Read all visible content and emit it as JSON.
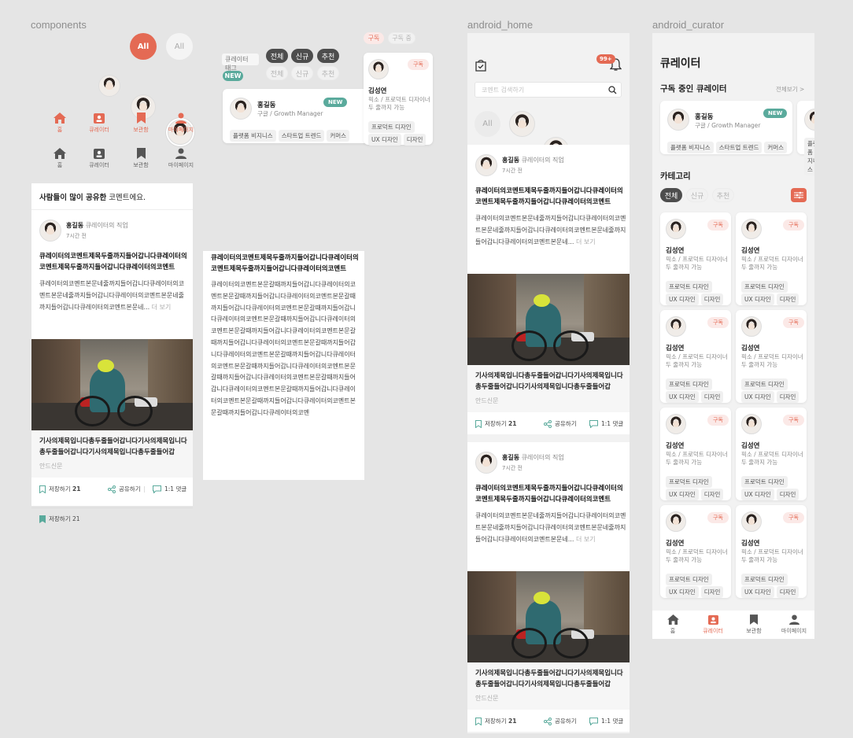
{
  "frames": {
    "components": "components",
    "android_home": "android_home",
    "android_curator": "android_curator"
  },
  "components": {
    "all_button_active": "All",
    "all_button_inactive": "All",
    "nav_active": [
      {
        "icon": "home-icon",
        "label": "홈"
      },
      {
        "icon": "curator-icon",
        "label": "큐레이터"
      },
      {
        "icon": "bookmark-icon",
        "label": "보관함"
      },
      {
        "icon": "person-icon",
        "label": "마이페이지"
      }
    ],
    "nav_inactive": [
      {
        "icon": "home-icon",
        "label": "홈"
      },
      {
        "icon": "curator-icon",
        "label": "큐레이터"
      },
      {
        "icon": "bookmark-icon",
        "label": "보관함"
      },
      {
        "icon": "person-icon",
        "label": "마이페이지"
      }
    ],
    "curator_tag_label": "큐레이터 태그",
    "new_badge": "NEW",
    "filter_dark": [
      "전체",
      "신규",
      "추천"
    ],
    "filter_light": [
      "전체",
      "신규",
      "추천"
    ],
    "sub_active": "구독",
    "sub_inactive": "구독 중",
    "profile_card": {
      "name": "홍길동",
      "role": "구글 / Growth Manager",
      "badge": "NEW",
      "tags": [
        "플랫폼 비지니스",
        "스타트업 트렌드",
        "커머스"
      ]
    },
    "curator_card": {
      "badge": "구독",
      "name": "김성연",
      "role": "픽소 / 프로덕트 디자이너 두 줄까지 가능",
      "tags": [
        "프로덕트 디자인",
        "UX 디자인",
        "디자인"
      ]
    },
    "share_header_bold": "사람들이 많이 공유한",
    "share_header_rest": " 코멘트에요.",
    "post": {
      "author": "홍길동",
      "author_job": "큐레이터의 직업",
      "time": "7시간 전",
      "title": "큐레이터의코멘트제목두줄까지들어갑니다큐레이터의코멘트제목두줄까지들어갑니다큐레이터의코멘트",
      "body": "큐레이터의코멘트본문네줄까지들어갑니다큐레이터의코멘트본문네줄까지들어갑니다큐레이터의코멘트본문네줄까지들어갑니다큐레이터의코멘트본문네...",
      "more": "더 보기",
      "caption": "기사의제목입니다총두줄들어갑니다기사의제목입니다총두줄들어갑니다기사의제목입니다총두줄들어갑",
      "source": "안드신문",
      "save_label": "저장하기",
      "save_count": "21",
      "share_label": "공유하기",
      "reply_label": "1:1 댓글"
    },
    "long_title": "큐레이터의코멘트제목두줄까지들어갑니다큐레이터의코멘트제목두줄까지들어갑니다큐레이터의코멘트",
    "long_body": "큐레이터의코멘트본문갈때까지들어갑니다큐레이터의코멘트본문갈때까지들어갑니다큐레이터의코멘트본문갈때까지들어갑니다큐레이터의코멘트본문갈때까지들어갑니다큐레이터의코멘트본문갈때까지들어갑니다큐레이터의코멘트본문갈때까지들어갑니다큐레이터의코멘트본문갈때까지들어갑니다큐레이터의코멘트본문갈때까지들어갑니다큐레이터의코멘트본문갈때까지들어갑니다큐레이터의코멘트본문갈때까지들어갑니다큐레이터의코멘트본문갈때까지들어갑니다큐레이터의코멘트본문갈때까지들어갑니다큐레이터의코멘트본문갈때까지들어갑니다큐레이터의코멘트본문갈때까지들어갑니다큐레이터의코멘트본문갈때까지들어갑니다큐레이터의코멘",
    "mini_save": "저장하기 21"
  },
  "home": {
    "notif_badge": "99+",
    "search_placeholder": "코멘트 검색하기",
    "all_chip": "All"
  },
  "curator_page": {
    "title": "큐레이터",
    "subscribed_heading": "구독 중인 큐레이터",
    "see_all": "전체보기 >",
    "category_heading": "카테고리",
    "tabs": [
      "전체",
      "신규",
      "추천"
    ],
    "nav": [
      {
        "label": "홈"
      },
      {
        "label": "큐레이터"
      },
      {
        "label": "보관함"
      },
      {
        "label": "마이페이지"
      }
    ]
  },
  "colors": {
    "accent": "#e46a54",
    "green": "#5aaa9c",
    "dark_chip": "#4d4d4d"
  }
}
